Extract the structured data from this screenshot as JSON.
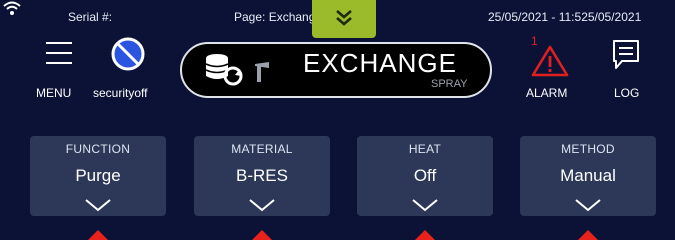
{
  "status": {
    "serial_label": "Serial #:",
    "page_label": "Page: Exchange",
    "datetime": "25/05/2021 - 11:525/05/2021"
  },
  "pull_tab": {
    "icon": "chevron-double-down-icon",
    "color": "#9bbb2a"
  },
  "toolbar": {
    "menu_label": "MENU",
    "security_label": "securityoff",
    "alarm_label": "ALARM",
    "alarm_count": "1",
    "log_label": "LOG"
  },
  "exchange": {
    "title": "EXCHANGE",
    "subtitle": "SPRAY"
  },
  "cards": [
    {
      "title": "FUNCTION",
      "value": "Purge"
    },
    {
      "title": "MATERIAL",
      "value": "B-RES"
    },
    {
      "title": "HEAT",
      "value": "Off"
    },
    {
      "title": "METHOD",
      "value": "Manual"
    }
  ],
  "colors": {
    "background": "#0b1236",
    "card": "#2d3858",
    "accent": "#9bbb2a",
    "alarm": "#e02020",
    "security": "#2b55e0",
    "marker": "#e8221a"
  }
}
